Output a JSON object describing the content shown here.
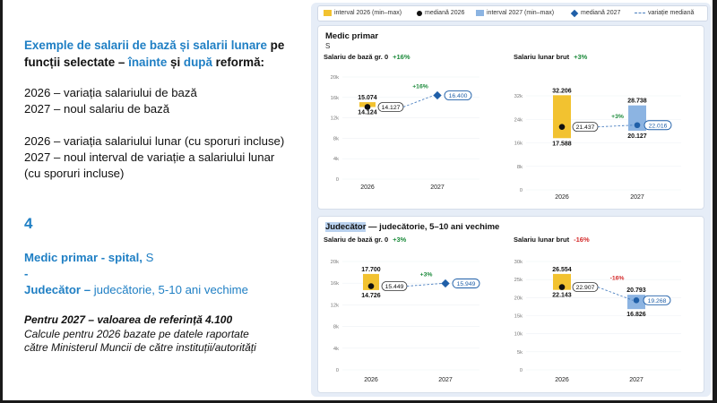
{
  "left": {
    "heading_part1": "Exemple de salarii de bază și salarii lunare",
    "heading_part2": "pe",
    "heading_part3": "funcții selectate –",
    "heading_part4": "înainte",
    "heading_part5": "și",
    "heading_part6": "după",
    "heading_part7": "reformă:",
    "line1": "2026 – variația salariului de bază",
    "line2": "2027 – noul salariu de bază",
    "line3": "2026 – variația salariului lunar (cu sporuri incluse)",
    "line4": "2027 – noul interval de variație a salariului lunar",
    "line5": "(cu sporuri incluse)",
    "number": "4",
    "job1_bold": "Medic primar - spital,",
    "job1_rest": " S",
    "job_sep": "-",
    "job2_bold": "Judecător –",
    "job2_rest": " judecătorie, 5-10 ani vechime",
    "note1": "Pentru 2027 – valoarea de referință 4.100",
    "note2": "Calcule pentru 2026 bazate pe datele raportate",
    "note3": "către Ministerul Muncii de către instituții/autorități"
  },
  "legend": {
    "item1": "interval 2026 (min–max)",
    "item2": "mediană 2026",
    "item3": "interval 2027 (min–max)",
    "item4": "mediană 2027",
    "item5": "variație mediană"
  },
  "colors": {
    "yellow": "#f2c230",
    "blue_bar": "#8cb4e2",
    "navy": "#1f5fa8",
    "positive": "#1b8a3a",
    "negative": "#d42a2a",
    "dashboard_bg": "#e6edf7"
  },
  "cards": [
    {
      "title_hl": "Medic primar",
      "title_rest": "",
      "subtitle": "S",
      "panels": [
        {
          "title": "Salariu de bază gr. 0",
          "variation": "+16%",
          "variation_sign": "pos"
        },
        {
          "title": "Salariu lunar brut",
          "variation": "+3%",
          "variation_sign": "pos"
        }
      ]
    },
    {
      "title_hl": "Judecător",
      "title_rest": " — judecătorie, 5–10 ani vechime",
      "subtitle": "",
      "panels": [
        {
          "title": "Salariu de bază gr. 0",
          "variation": "+3%",
          "variation_sign": "pos"
        },
        {
          "title": "Salariu lunar brut",
          "variation": "-16%",
          "variation_sign": "neg"
        }
      ]
    }
  ],
  "chart_data": [
    {
      "type": "range-bar",
      "title": "Salariu de bază gr. 0",
      "categories": [
        "2026",
        "2027"
      ],
      "ylim": [
        0,
        20000
      ],
      "yticks": [
        "0",
        "4k",
        "8k",
        "12k",
        "16k",
        "20k"
      ],
      "yticks_values": [
        0,
        4000,
        8000,
        12000,
        16000,
        20000
      ],
      "interval_2026": {
        "min": 14124,
        "max": 15074,
        "min_label": "14.124",
        "max_label": "15.074"
      },
      "median_2026": {
        "value": 14127,
        "label": "14.127"
      },
      "median_2027": {
        "value": 16400,
        "label": "16.400"
      },
      "variation": "+16%",
      "variation_sign": "pos"
    },
    {
      "type": "range-bar",
      "title": "Salariu lunar brut",
      "categories": [
        "2026",
        "2027"
      ],
      "ylim": [
        0,
        32000
      ],
      "yticks": [
        "0",
        "8k",
        "16k",
        "24k",
        "32k"
      ],
      "yticks_values": [
        0,
        8000,
        16000,
        24000,
        32000
      ],
      "interval_2026": {
        "min": 17588,
        "max": 32206,
        "min_label": "17.588",
        "max_label": "32.206"
      },
      "median_2026": {
        "value": 21437,
        "label": "21.437"
      },
      "interval_2027": {
        "min": 20127,
        "max": 28738,
        "min_label": "20.127",
        "max_label": "28.738"
      },
      "median_2027": {
        "value": 22016,
        "label": "22.016"
      },
      "variation": "+3%",
      "variation_sign": "pos"
    },
    {
      "type": "range-bar",
      "title": "Salariu de bază gr. 0",
      "categories": [
        "2026",
        "2027"
      ],
      "ylim": [
        0,
        20000
      ],
      "yticks": [
        "0",
        "4k",
        "8k",
        "12k",
        "16k",
        "20k"
      ],
      "yticks_values": [
        0,
        4000,
        8000,
        12000,
        16000,
        20000
      ],
      "interval_2026": {
        "min": 14726,
        "max": 17700,
        "min_label": "14.726",
        "max_label": "17.700"
      },
      "median_2026": {
        "value": 15449,
        "label": "15.449"
      },
      "median_2027": {
        "value": 15949,
        "label": "15.949"
      },
      "variation": "+3%",
      "variation_sign": "pos"
    },
    {
      "type": "range-bar",
      "title": "Salariu lunar brut",
      "categories": [
        "2026",
        "2027"
      ],
      "ylim": [
        0,
        30000
      ],
      "yticks": [
        "0",
        "5k",
        "10k",
        "15k",
        "20k",
        "25k",
        "30k"
      ],
      "yticks_values": [
        0,
        5000,
        10000,
        15000,
        20000,
        25000,
        30000
      ],
      "interval_2026": {
        "min": 22143,
        "max": 26554,
        "min_label": "22.143",
        "max_label": "26.554"
      },
      "median_2026": {
        "value": 22907,
        "label": "22.907"
      },
      "interval_2027": {
        "min": 16826,
        "max": 20793,
        "min_label": "16.826",
        "max_label": "20.793"
      },
      "median_2027": {
        "value": 19268,
        "label": "19.268"
      },
      "variation": "-16%",
      "variation_sign": "neg"
    }
  ]
}
